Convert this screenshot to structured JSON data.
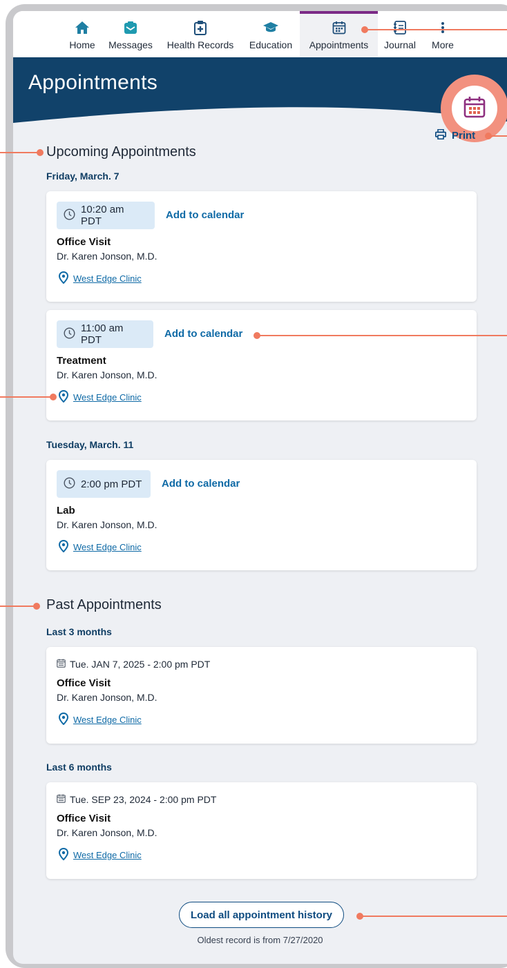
{
  "nav": {
    "items": [
      {
        "label": "Home",
        "icon": "home-icon"
      },
      {
        "label": "Messages",
        "icon": "messages-icon"
      },
      {
        "label": "Health Records",
        "icon": "health-records-icon"
      },
      {
        "label": "Education",
        "icon": "education-icon"
      },
      {
        "label": "Appointments",
        "icon": "calendar-icon",
        "active": true
      },
      {
        "label": "Journal",
        "icon": "journal-icon"
      },
      {
        "label": "More",
        "icon": "more-icon"
      }
    ]
  },
  "header": {
    "title": "Appointments"
  },
  "print_label": "Print",
  "upcoming": {
    "title": "Upcoming Appointments",
    "groups": [
      {
        "date": "Friday, March. 7",
        "appointments": [
          {
            "time": "10:20 am PDT",
            "add_label": "Add to calendar",
            "type": "Office Visit",
            "doctor": "Dr. Karen Jonson, M.D.",
            "location": "West Edge Clinic"
          },
          {
            "time": "11:00 am PDT",
            "add_label": "Add to calendar",
            "type": "Treatment",
            "doctor": "Dr. Karen Jonson, M.D.",
            "location": "West Edge Clinic"
          }
        ]
      },
      {
        "date": "Tuesday, March. 11",
        "appointments": [
          {
            "time": "2:00 pm PDT",
            "add_label": "Add to calendar",
            "type": "Lab",
            "doctor": "Dr. Karen Jonson, M.D.",
            "location": "West Edge Clinic"
          }
        ]
      }
    ]
  },
  "past": {
    "title": "Past Appointments",
    "groups": [
      {
        "period": "Last 3 months",
        "appointments": [
          {
            "datetime": "Tue. JAN 7, 2025 - 2:00 pm PDT",
            "type": "Office Visit",
            "doctor": "Dr. Karen Jonson, M.D.",
            "location": "West Edge Clinic"
          }
        ]
      },
      {
        "period": "Last 6 months",
        "appointments": [
          {
            "datetime": "Tue. SEP 23, 2024 - 2:00 pm PDT",
            "type": "Office Visit",
            "doctor": "Dr. Karen Jonson, M.D.",
            "location": "West Edge Clinic"
          }
        ]
      }
    ]
  },
  "load_all_label": "Load all appointment history",
  "oldest_record": "Oldest record is from 7/27/2020",
  "colors": {
    "header_bg": "#11426a",
    "accent": "#0f6aa6",
    "callout": "#f07a5f",
    "active_tab": "#7b2a86",
    "badge": "#f2917f"
  }
}
